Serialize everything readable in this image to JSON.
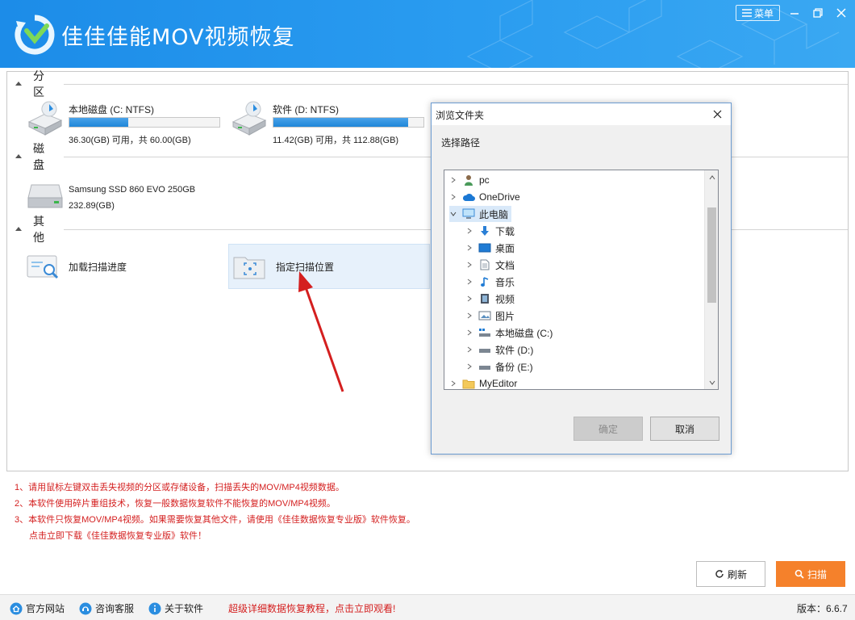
{
  "app": {
    "title": "佳佳佳能MOV视频恢复",
    "menu_label": "菜单"
  },
  "sections": {
    "partition": "分区",
    "disk": "磁盘",
    "other": "其他"
  },
  "partitions": [
    {
      "name": "本地磁盘 (C: NTFS)",
      "info": "36.30(GB) 可用，共 60.00(GB)",
      "used_fraction": 0.395
    },
    {
      "name": "软件 (D: NTFS)",
      "info": "11.42(GB) 可用，共 112.88(GB)",
      "used_fraction": 0.899
    }
  ],
  "disks": [
    {
      "name": "Samsung SSD 860 EVO 250GB",
      "info": "232.89(GB)"
    }
  ],
  "others": [
    {
      "label": "加载扫描进度"
    },
    {
      "label": "指定扫描位置"
    }
  ],
  "notes": [
    "1、请用鼠标左键双击丢失视频的分区或存储设备，扫描丢失的MOV/MP4视频数据。",
    "2、本软件使用碎片重组技术，恢复一般数据恢复软件不能恢复的MOV/MP4视频。",
    "3、本软件只恢复MOV/MP4视频。如果需要恢复其他文件，请使用《佳佳数据恢复专业版》软件恢复。",
    "点击立即下载《佳佳数据恢复专业版》软件！"
  ],
  "buttons": {
    "refresh": "刷新",
    "scan": "扫描"
  },
  "bottom": {
    "website": "官方网站",
    "support": "咨询客服",
    "about": "关于软件",
    "promo": "超级详细数据恢复教程，点击立即观看!",
    "version": "版本：6.6.7"
  },
  "dialog": {
    "title": "浏览文件夹",
    "description": "选择路径",
    "ok": "确定",
    "cancel": "取消",
    "tree": [
      {
        "label": "pc",
        "icon": "user-icon"
      },
      {
        "label": "OneDrive",
        "icon": "cloud-icon"
      },
      {
        "label": "此电脑",
        "icon": "computer-icon",
        "expanded": true,
        "selected": true
      },
      {
        "label": "下载",
        "icon": "download-icon"
      },
      {
        "label": "桌面",
        "icon": "desktop-icon"
      },
      {
        "label": "文档",
        "icon": "document-icon"
      },
      {
        "label": "音乐",
        "icon": "music-icon"
      },
      {
        "label": "视频",
        "icon": "video-icon"
      },
      {
        "label": "图片",
        "icon": "picture-icon"
      },
      {
        "label": "本地磁盘 (C:)",
        "icon": "system-drive-icon"
      },
      {
        "label": "软件 (D:)",
        "icon": "drive-icon"
      },
      {
        "label": "备份 (E:)",
        "icon": "drive-icon"
      },
      {
        "label": "MyEditor",
        "icon": "folder-icon"
      }
    ]
  },
  "colors": {
    "title_bar": "#2a9cf0",
    "accent_orange": "#f5812b",
    "note_red": "#d42020"
  }
}
